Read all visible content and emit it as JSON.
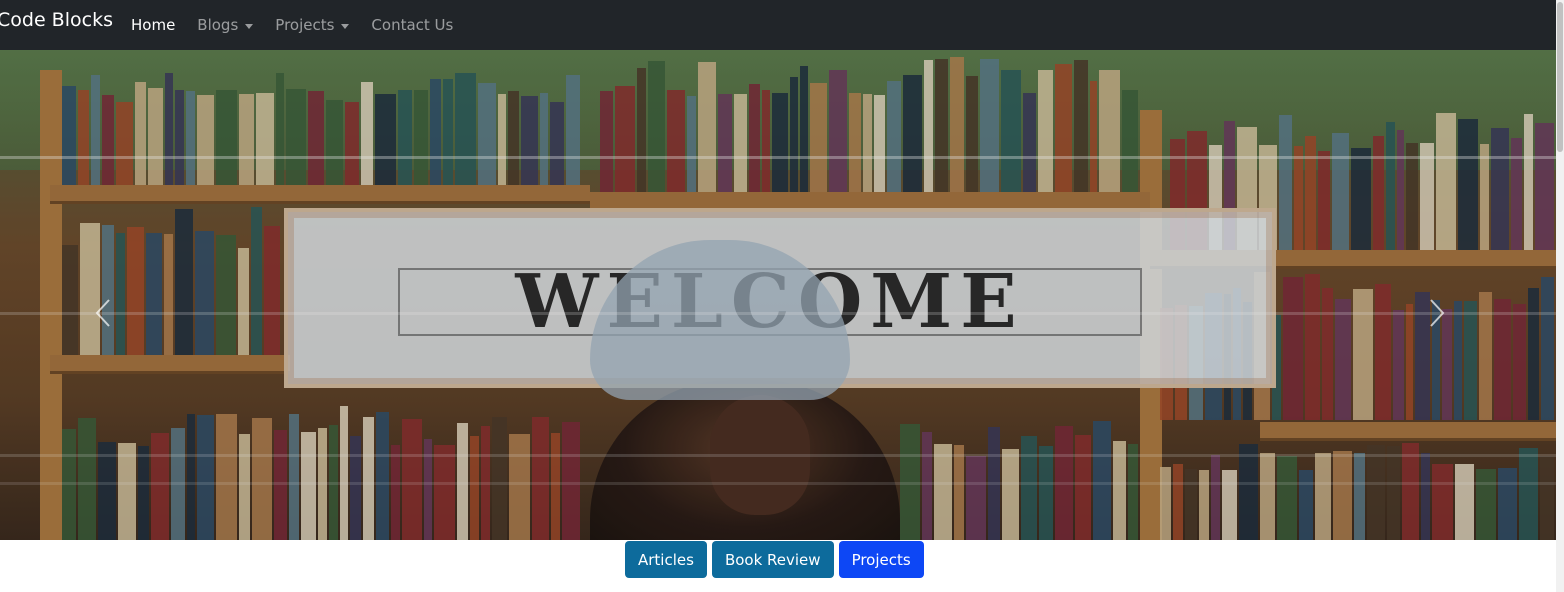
{
  "navbar": {
    "brand": "Code Blocks",
    "items": [
      {
        "label": "Home",
        "active": true,
        "dropdown": false
      },
      {
        "label": "Blogs",
        "active": false,
        "dropdown": true
      },
      {
        "label": "Projects",
        "active": false,
        "dropdown": true
      },
      {
        "label": "Contact Us",
        "active": false,
        "dropdown": false
      }
    ]
  },
  "hero": {
    "sign_text": "WELCOME",
    "prev_icon": "chevron-left-icon",
    "next_icon": "chevron-right-icon"
  },
  "buttons": [
    {
      "label": "Articles",
      "color": "#0d6b9c"
    },
    {
      "label": "Book Review",
      "color": "#0d6b9c"
    },
    {
      "label": "Projects",
      "color": "#0d47f5"
    }
  ],
  "colors": {
    "navbar_bg": "#212529",
    "accent_primary": "#0d47f5",
    "accent_info": "#0d6b9c"
  }
}
